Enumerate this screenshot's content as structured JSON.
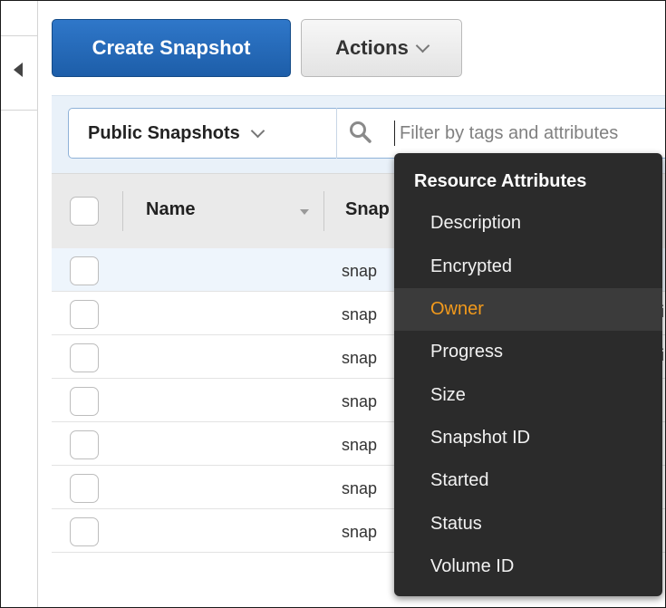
{
  "toolbar": {
    "create_label": "Create Snapshot",
    "actions_label": "Actions"
  },
  "filter": {
    "scope_label": "Public Snapshots",
    "search_placeholder": "Filter by tags and attributes"
  },
  "table": {
    "columns": [
      "Name",
      "Snap"
    ],
    "rows": [
      {
        "name": "",
        "snapshot": "snap",
        "trailing": ""
      },
      {
        "name": "",
        "snapshot": "snap",
        "trailing": "i"
      },
      {
        "name": "",
        "snapshot": "snap",
        "trailing": "i"
      },
      {
        "name": "",
        "snapshot": "snap",
        "trailing": ""
      },
      {
        "name": "",
        "snapshot": "snap",
        "trailing": ""
      },
      {
        "name": "",
        "snapshot": "snap",
        "trailing": ""
      },
      {
        "name": "",
        "snapshot": "snap",
        "trailing": ""
      }
    ]
  },
  "menu": {
    "header": "Resource Attributes",
    "items": [
      "Description",
      "Encrypted",
      "Owner",
      "Progress",
      "Size",
      "Snapshot ID",
      "Started",
      "Status",
      "Volume ID"
    ],
    "active": "Owner"
  },
  "colors": {
    "primary_button": "#1d5ea9",
    "menu_bg": "#2b2b2b",
    "menu_active_text": "#f29a1c",
    "selected_row": "#eef5fc"
  }
}
